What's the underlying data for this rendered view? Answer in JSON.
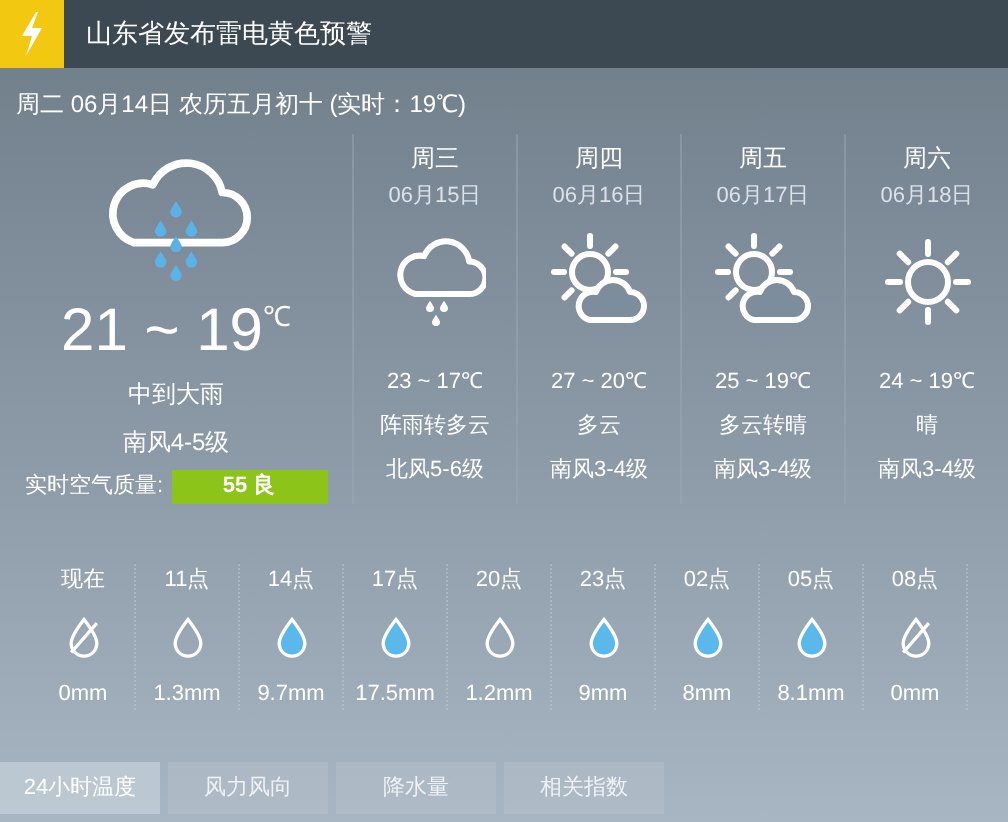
{
  "alert": {
    "title": "山东省发布雷电黄色预警"
  },
  "today": {
    "date_line": "周二 06月14日 农历五月初十 (实时：19℃)",
    "kind": "heavy-rain",
    "temp": "21 ~ 19",
    "unit": "℃",
    "condition": "中到大雨",
    "wind": "南风4-5级",
    "aqi_label": "实时空气质量:",
    "aqi_value": "55 良"
  },
  "forecast": [
    {
      "day": "周三",
      "date": "06月15日",
      "kind": "rain",
      "temp": "23 ~ 17℃",
      "condition": "阵雨转多云",
      "wind": "北风5-6级"
    },
    {
      "day": "周四",
      "date": "06月16日",
      "kind": "partly-cloudy",
      "temp": "27 ~ 20℃",
      "condition": "多云",
      "wind": "南风3-4级"
    },
    {
      "day": "周五",
      "date": "06月17日",
      "kind": "partly-cloudy",
      "temp": "25 ~ 19℃",
      "condition": "多云转晴",
      "wind": "南风3-4级"
    },
    {
      "day": "周六",
      "date": "06月18日",
      "kind": "sunny",
      "temp": "24 ~ 19℃",
      "condition": "晴",
      "wind": "南风3-4级"
    }
  ],
  "hourly": [
    {
      "time": "现在",
      "kind": "none",
      "amount": "0mm"
    },
    {
      "time": "11点",
      "kind": "light",
      "amount": "1.3mm"
    },
    {
      "time": "14点",
      "kind": "rain",
      "amount": "9.7mm"
    },
    {
      "time": "17点",
      "kind": "rain",
      "amount": "17.5mm"
    },
    {
      "time": "20点",
      "kind": "light",
      "amount": "1.2mm"
    },
    {
      "time": "23点",
      "kind": "rain",
      "amount": "9mm"
    },
    {
      "time": "02点",
      "kind": "rain",
      "amount": "8mm"
    },
    {
      "time": "05点",
      "kind": "rain",
      "amount": "8.1mm"
    },
    {
      "time": "08点",
      "kind": "none",
      "amount": "0mm"
    }
  ],
  "tabs": [
    {
      "label": "24小时温度",
      "selected": true
    },
    {
      "label": "风力风向",
      "selected": false
    },
    {
      "label": "降水量",
      "selected": false
    },
    {
      "label": "相关指数",
      "selected": false
    }
  ]
}
